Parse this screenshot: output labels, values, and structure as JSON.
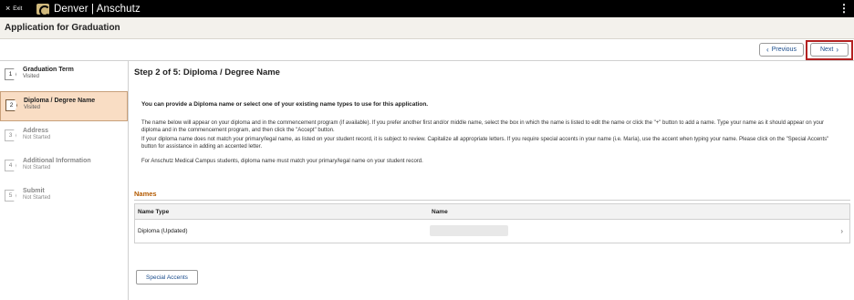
{
  "topbar": {
    "exit_label": "Exit",
    "exit_icon": "×",
    "brand": "Denver | Anschutz",
    "menu_icon": "⋮"
  },
  "title": "Application for Graduation",
  "nav": {
    "previous_label": "Previous",
    "next_label": "Next",
    "prev_icon": "‹",
    "next_icon": "›"
  },
  "steps": [
    {
      "num": "1",
      "title": "Graduation Term",
      "status": "Visited"
    },
    {
      "num": "2",
      "title": "Diploma / Degree Name",
      "status": "Visited"
    },
    {
      "num": "3",
      "title": "Address",
      "status": "Not Started"
    },
    {
      "num": "4",
      "title": "Additional Information",
      "status": "Not Started"
    },
    {
      "num": "5",
      "title": "Submit",
      "status": "Not Started"
    }
  ],
  "main": {
    "heading": "Step 2 of 5: Diploma / Degree Name",
    "intro": "You can provide a Diploma name or select one of your existing name types to use for this application.",
    "para1": "The name below will appear on your diploma and in the commencement program (if available). If you prefer another first and/or middle name, select the box in which the name is listed to edit the name or click the \"+\" button to add a name. Type your name as it should appear on your diploma and in the commencement program, and then click the \"Accept\" button.",
    "para2": "If your diploma name does not match your primary/legal name, as listed on your student record, it is subject to review. Capitalize all appropriate letters. If you require special accents in your name (i.e. María), use the accent when typing your name. Please click on the \"Special Accents\" button for assistance in adding an accented letter.",
    "para3": "For Anschutz Medical Campus students, diploma name must match your primary/legal name on your student record.",
    "names_label": "Names",
    "col_name_type": "Name Type",
    "col_name": "Name",
    "row_name_type": "Diploma (Updated)",
    "row_chevron": "›",
    "special_accents": "Special Accents"
  }
}
